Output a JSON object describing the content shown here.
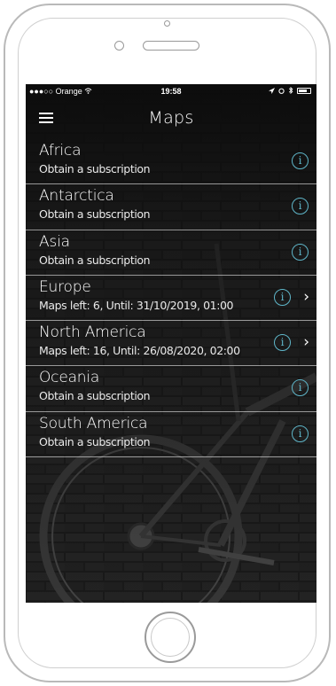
{
  "status_bar": {
    "carrier": "●●●○○ Orange",
    "time": "19:58",
    "wifi_icon": "wifi-icon",
    "location_icon": "location-arrow-icon",
    "alarm_icon": "alarm-icon",
    "bluetooth_icon": "bluetooth-icon",
    "battery_icon": "battery-icon"
  },
  "nav": {
    "title": "Maps",
    "menu_icon": "hamburger-menu-icon"
  },
  "colors": {
    "accent": "#5fb6c9",
    "background": "#0c0c0c",
    "text": "#ffffff"
  },
  "maps": [
    {
      "name": "Africa",
      "detail": "Obtain a subscription",
      "info_glyph": "i",
      "has_chevron": false
    },
    {
      "name": "Antarctica",
      "detail": "Obtain a subscription",
      "info_glyph": "i",
      "has_chevron": false
    },
    {
      "name": "Asia",
      "detail": "Obtain a subscription",
      "info_glyph": "i",
      "has_chevron": false
    },
    {
      "name": "Europe",
      "detail": "Maps left: 6, Until: 31/10/2019, 01:00",
      "info_glyph": "i",
      "has_chevron": true,
      "chevron": "›"
    },
    {
      "name": "North America",
      "detail": "Maps left: 16, Until: 26/08/2020, 02:00",
      "info_glyph": "i",
      "has_chevron": true,
      "chevron": "›"
    },
    {
      "name": "Oceania",
      "detail": "Obtain a subscription",
      "info_glyph": "i",
      "has_chevron": false
    },
    {
      "name": "South America",
      "detail": "Obtain a subscription",
      "info_glyph": "i",
      "has_chevron": false
    }
  ]
}
